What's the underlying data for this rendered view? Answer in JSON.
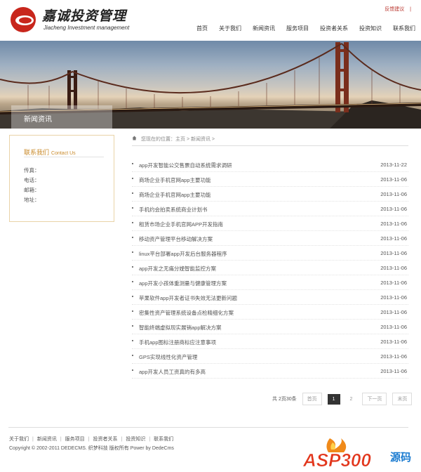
{
  "brand": {
    "name_cn": "嘉诚投资管理",
    "name_en": "Jiacheng Investment management"
  },
  "top_links": {
    "feedback": "反馈建议",
    "separator": "|"
  },
  "nav": [
    "首页",
    "关于我们",
    "新闻资讯",
    "服务项目",
    "投资者关系",
    "投资知识",
    "联系我们"
  ],
  "banner": {
    "section_title": "新闻资讯"
  },
  "sidebar": {
    "title": "联系我们",
    "title_en": "Contact Us",
    "fields": [
      "传真：",
      "电话：",
      "邮箱：",
      "地址："
    ]
  },
  "breadcrumb": {
    "text": "您现在的位置：主页 > 新闻资讯 >"
  },
  "news": [
    {
      "title": "app开发智能公交售票自动系统需求调研",
      "date": "2013-11-22"
    },
    {
      "title": "商场企业手机官网app主要功能",
      "date": "2013-11-06"
    },
    {
      "title": "商场企业手机官网app主要功能",
      "date": "2013-11-06"
    },
    {
      "title": "手机约会拍卖系统商业计划书",
      "date": "2013-11-06"
    },
    {
      "title": "租赁市场企业手机官网APP开发指南",
      "date": "2013-11-06"
    },
    {
      "title": "移动资产管理平台移动解决方案",
      "date": "2013-11-06"
    },
    {
      "title": "linux平台部署app开发后台服务器程序",
      "date": "2013-11-06"
    },
    {
      "title": "app开发之无痛分娩智能监控方案",
      "date": "2013-11-06"
    },
    {
      "title": "app开发小孩体重测量与健康管理方案",
      "date": "2013-11-06"
    },
    {
      "title": "苹果软件app开发者证书失效无法更新问题",
      "date": "2013-11-06"
    },
    {
      "title": "密集性资产管理系统设备点检精细化方案",
      "date": "2013-11-06"
    },
    {
      "title": "智能终端虚拟现实展销app解决方案",
      "date": "2013-11-06"
    },
    {
      "title": "手机app图标注册商标应注意事项",
      "date": "2013-11-06"
    },
    {
      "title": "GPS实现线性化资产管理",
      "date": "2013-11-06"
    },
    {
      "title": "app开发人员工资真的有多高",
      "date": "2013-11-06"
    }
  ],
  "pager": {
    "info": "共 2页30条",
    "first": "首页",
    "current": "1",
    "page2": "2",
    "next": "下一页",
    "last": "末页"
  },
  "footer": {
    "links": [
      "关于我们",
      "新闻资讯",
      "服务项目",
      "投资者关系",
      "投资知识",
      "联系我们"
    ],
    "copyright": "Copyright © 2002-2011 DEDECMS. 织梦科技 版权所有  Power by DedeCms"
  },
  "watermark": {
    "text": "ASP300",
    "suffix": "源码"
  },
  "colors": {
    "accent": "#b8322a",
    "sidebar_accent": "#c98a2a"
  }
}
